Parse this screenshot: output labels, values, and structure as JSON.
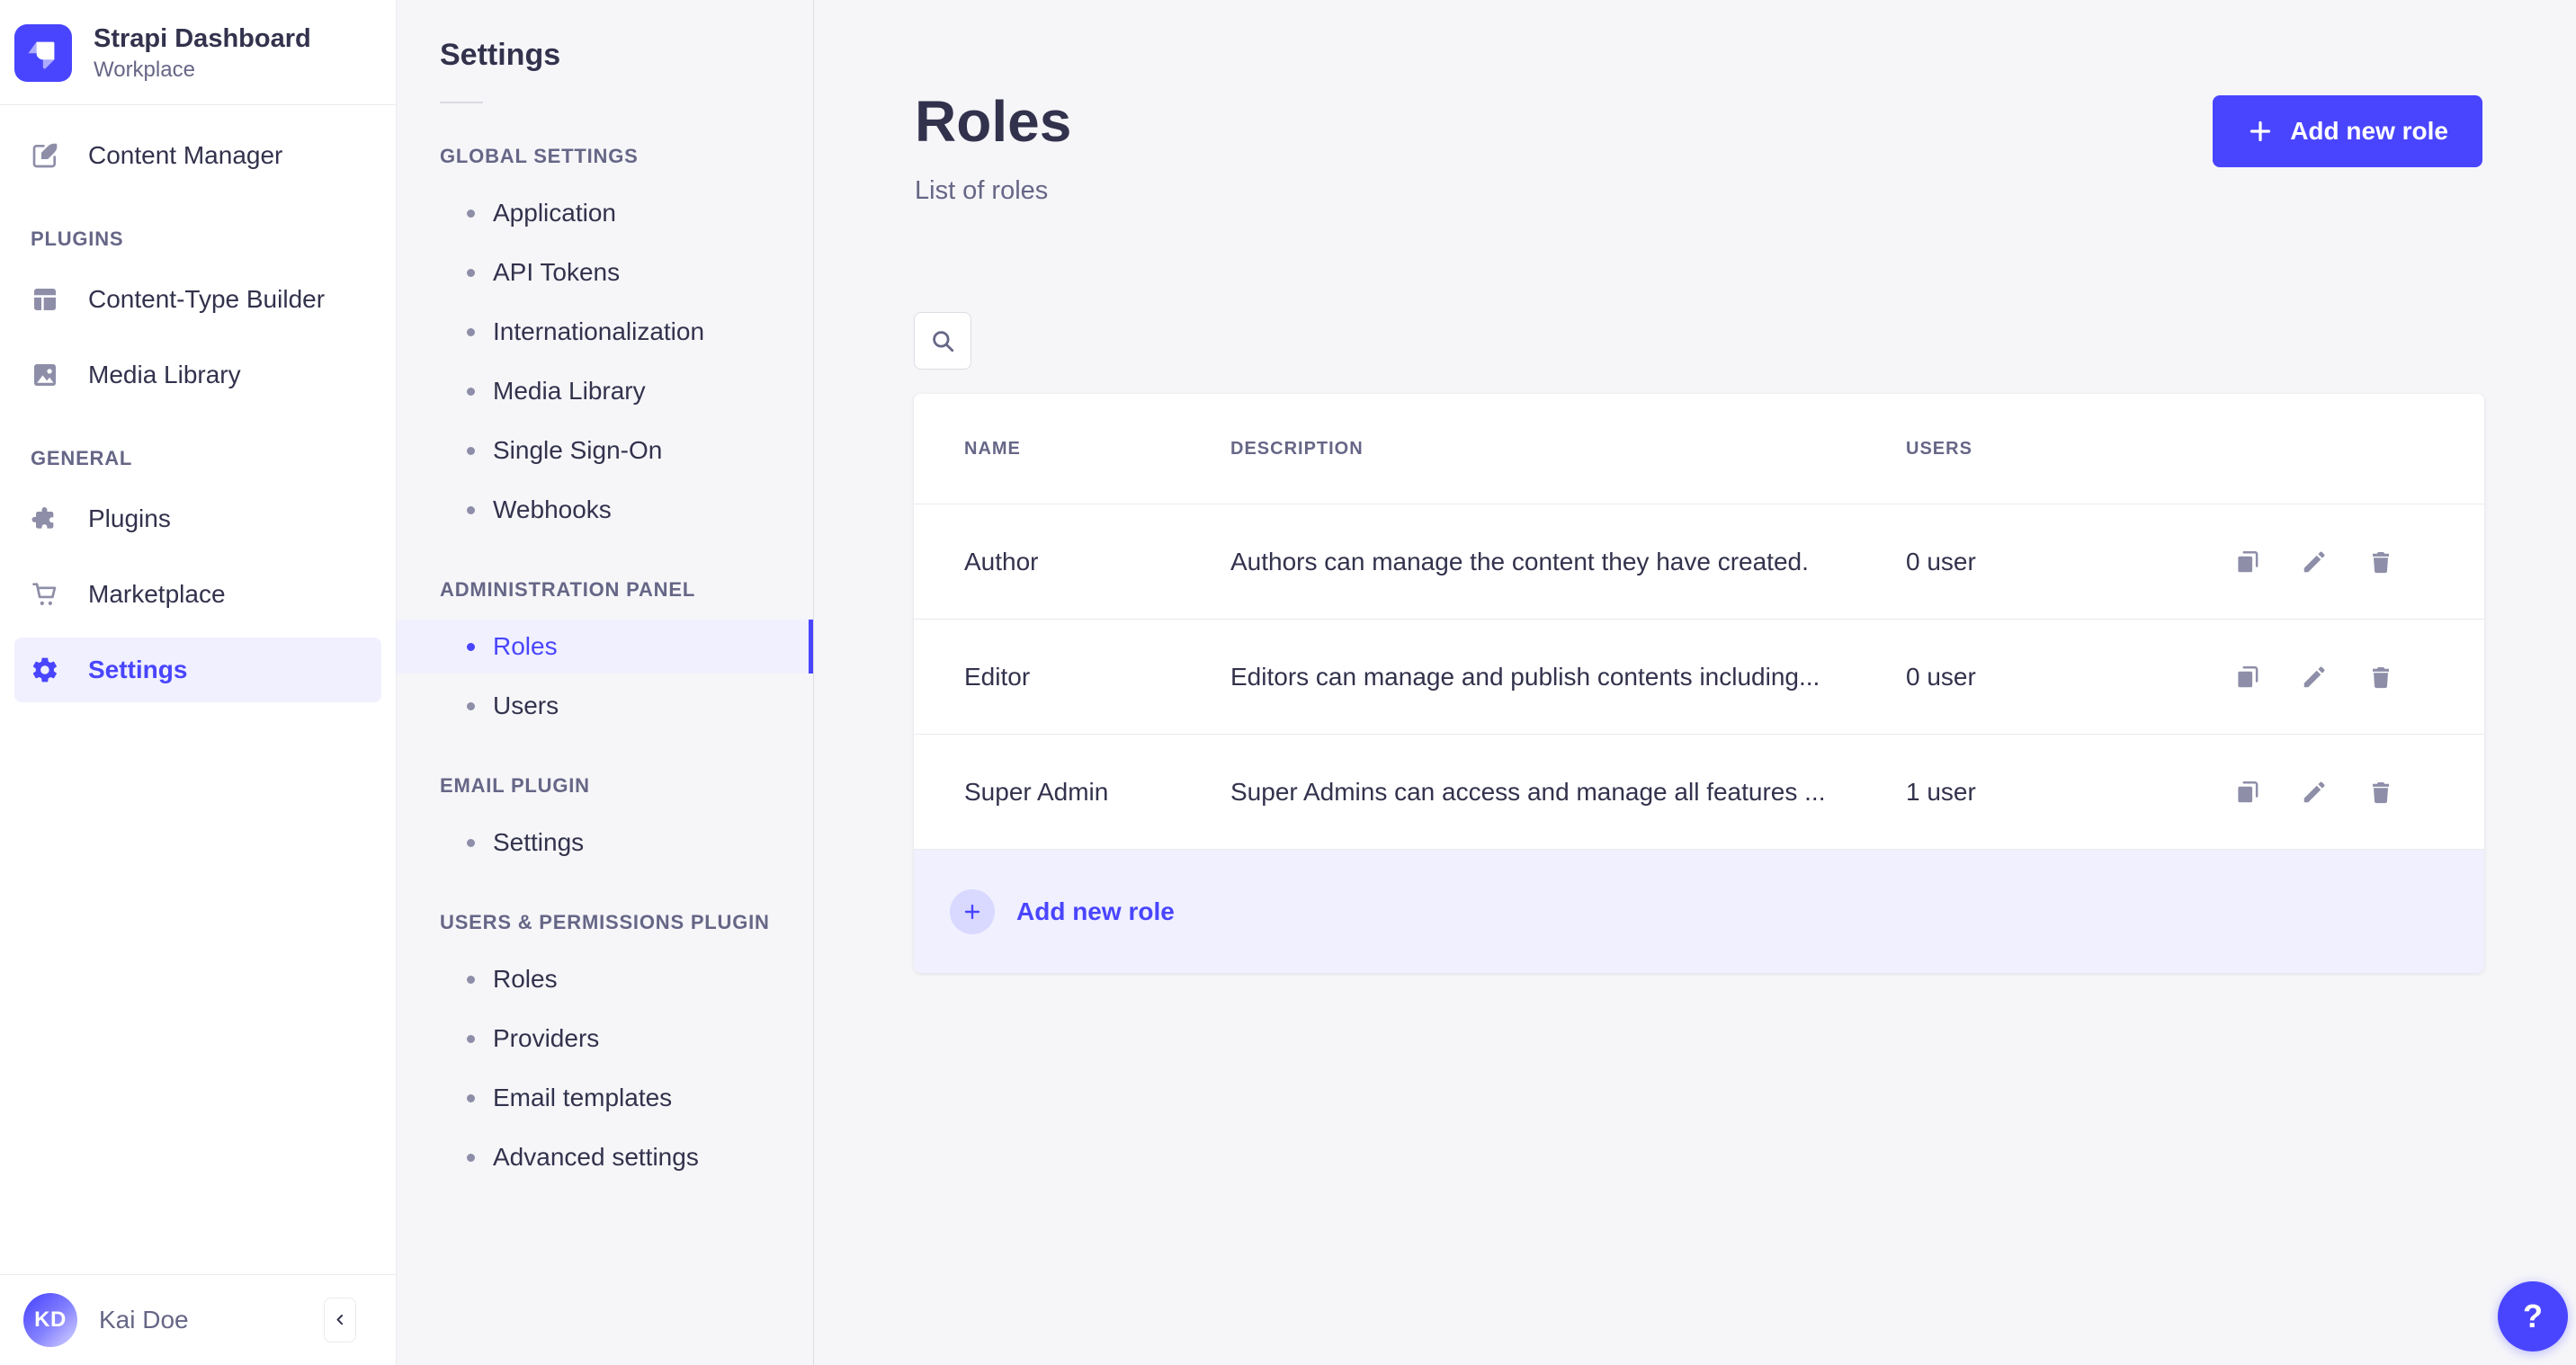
{
  "colors": {
    "primary": "#4945ff",
    "primary_light": "#f0f0ff",
    "primary_chip": "#d9d8ff",
    "text_dark": "#32324d",
    "text_muted": "#666687",
    "icon_muted": "#8e8ea9",
    "surface": "#ffffff",
    "background": "#f6f6f9",
    "border": "#eaeaef"
  },
  "brand": {
    "title": "Strapi Dashboard",
    "subtitle": "Workplace",
    "logo_icon": "strapi-logo-icon"
  },
  "sidebar": {
    "groups": [
      {
        "label": "",
        "items": [
          {
            "label": "Content Manager",
            "icon": "pen-icon",
            "active": false
          }
        ]
      },
      {
        "label": "PLUGINS",
        "items": [
          {
            "label": "Content-Type Builder",
            "icon": "layout-icon",
            "active": false
          },
          {
            "label": "Media Library",
            "icon": "image-icon",
            "active": false
          }
        ]
      },
      {
        "label": "GENERAL",
        "items": [
          {
            "label": "Plugins",
            "icon": "puzzle-icon",
            "active": false
          },
          {
            "label": "Marketplace",
            "icon": "cart-icon",
            "active": false
          },
          {
            "label": "Settings",
            "icon": "gear-icon",
            "active": true
          }
        ]
      }
    ],
    "footer": {
      "user_initials": "KD",
      "user_name": "Kai Doe",
      "collapse_icon": "chevron-left-icon"
    }
  },
  "subnav": {
    "title": "Settings",
    "sections": [
      {
        "label": "GLOBAL SETTINGS",
        "items": [
          {
            "label": "Application",
            "active": false
          },
          {
            "label": "API Tokens",
            "active": false
          },
          {
            "label": "Internationalization",
            "active": false
          },
          {
            "label": "Media Library",
            "active": false
          },
          {
            "label": "Single Sign-On",
            "active": false
          },
          {
            "label": "Webhooks",
            "active": false
          }
        ]
      },
      {
        "label": "ADMINISTRATION PANEL",
        "items": [
          {
            "label": "Roles",
            "active": true
          },
          {
            "label": "Users",
            "active": false
          }
        ]
      },
      {
        "label": "EMAIL PLUGIN",
        "items": [
          {
            "label": "Settings",
            "active": false
          }
        ]
      },
      {
        "label": "USERS & PERMISSIONS PLUGIN",
        "items": [
          {
            "label": "Roles",
            "active": false
          },
          {
            "label": "Providers",
            "active": false
          },
          {
            "label": "Email templates",
            "active": false
          },
          {
            "label": "Advanced settings",
            "active": false
          }
        ]
      }
    ]
  },
  "main": {
    "title": "Roles",
    "subtitle": "List of roles",
    "add_button_label": "Add new role",
    "add_button_icon": "plus-icon",
    "search_icon": "search-icon",
    "help_label": "?",
    "table": {
      "columns": [
        "NAME",
        "DESCRIPTION",
        "USERS"
      ],
      "rows": [
        {
          "name": "Author",
          "description": "Authors can manage the content they have created.",
          "users": "0 user"
        },
        {
          "name": "Editor",
          "description": "Editors can manage and publish contents including...",
          "users": "0 user"
        },
        {
          "name": "Super Admin",
          "description": "Super Admins can access and manage all features ...",
          "users": "1 user"
        }
      ],
      "row_actions": [
        "duplicate-icon",
        "edit-icon",
        "delete-icon"
      ],
      "footer_action_label": "Add new role",
      "footer_action_icon": "plus-icon"
    }
  }
}
